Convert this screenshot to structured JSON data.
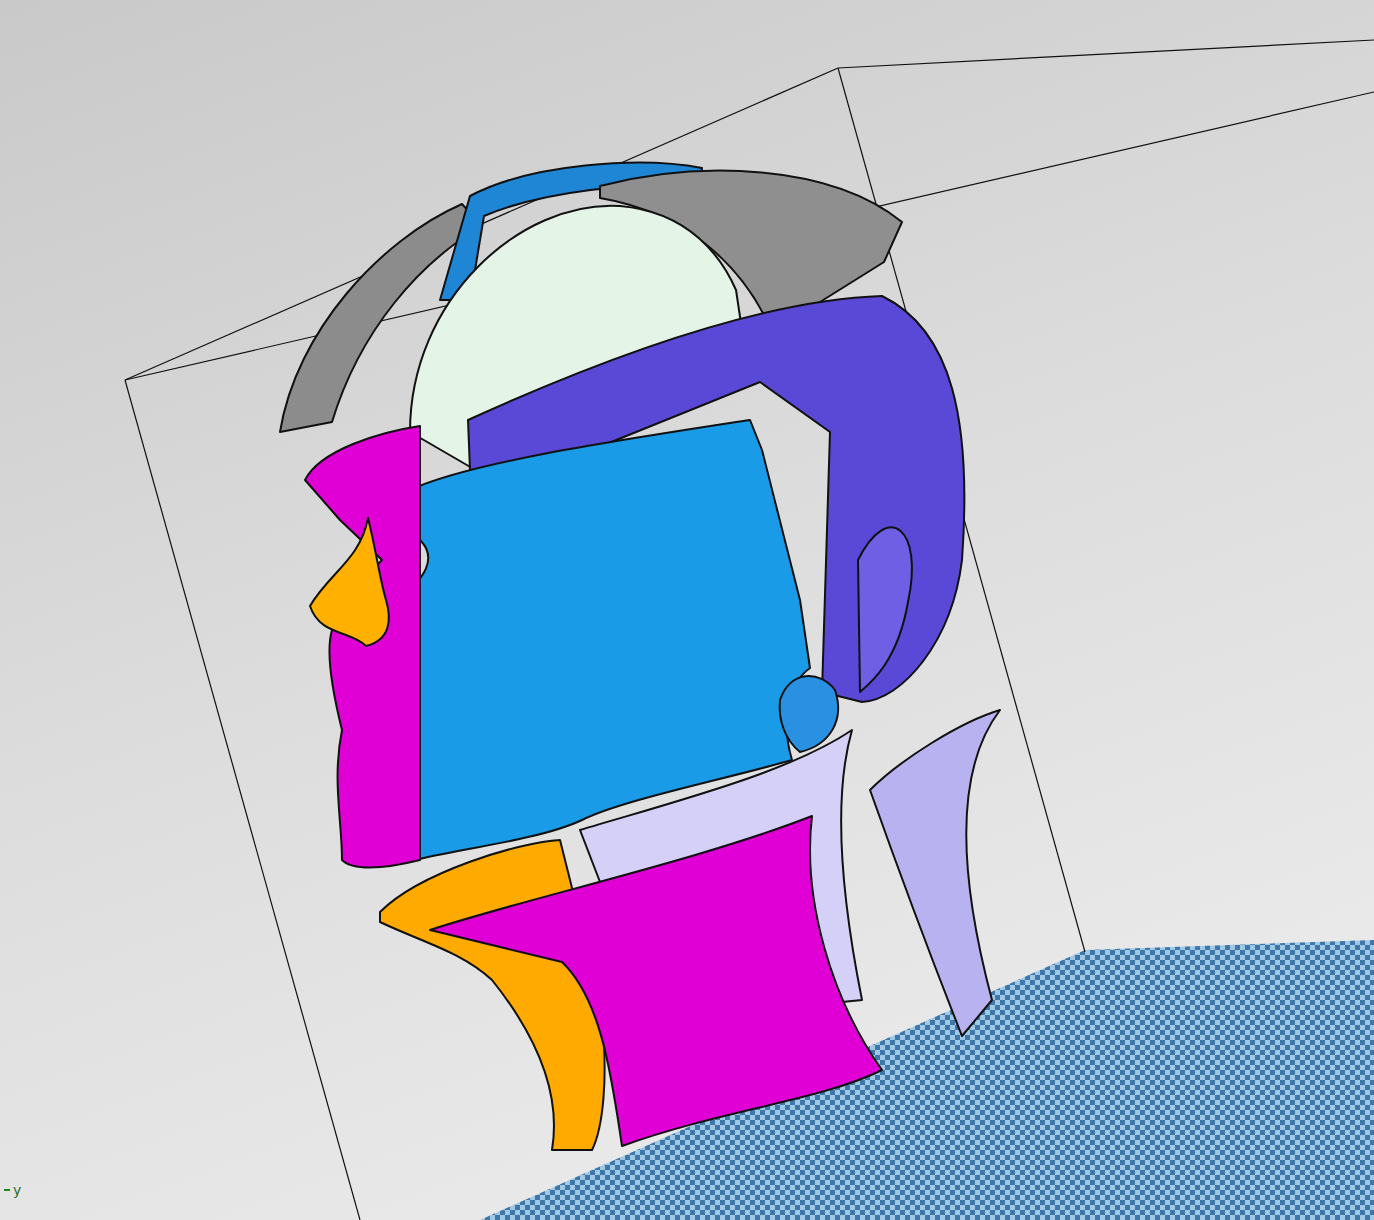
{
  "viewport": {
    "axis_label": "y"
  },
  "parts": [
    {
      "kind": "crownleft",
      "color": "#8c8c8c"
    },
    {
      "kind": "crowntop",
      "color": "#1f86d6"
    },
    {
      "kind": "crownright",
      "color": "#8f8f8f"
    },
    {
      "kind": "brain",
      "color": "#e4f4e6"
    },
    {
      "kind": "backhead",
      "color": "#5a48d6"
    },
    {
      "kind": "ear",
      "color": "#6f5fe4"
    },
    {
      "kind": "face",
      "color": "#1a9be8"
    },
    {
      "kind": "jaw",
      "color": "#2a90e2"
    },
    {
      "kind": "profile",
      "color": "#e000d6"
    },
    {
      "kind": "nose",
      "color": "#ffb000"
    },
    {
      "kind": "neckback",
      "color": "#d4d0f8"
    },
    {
      "kind": "neckstrip",
      "color": "#b9b2f0"
    },
    {
      "kind": "chin",
      "color": "#ffaa00"
    },
    {
      "kind": "neck",
      "color": "#e000d6"
    }
  ]
}
